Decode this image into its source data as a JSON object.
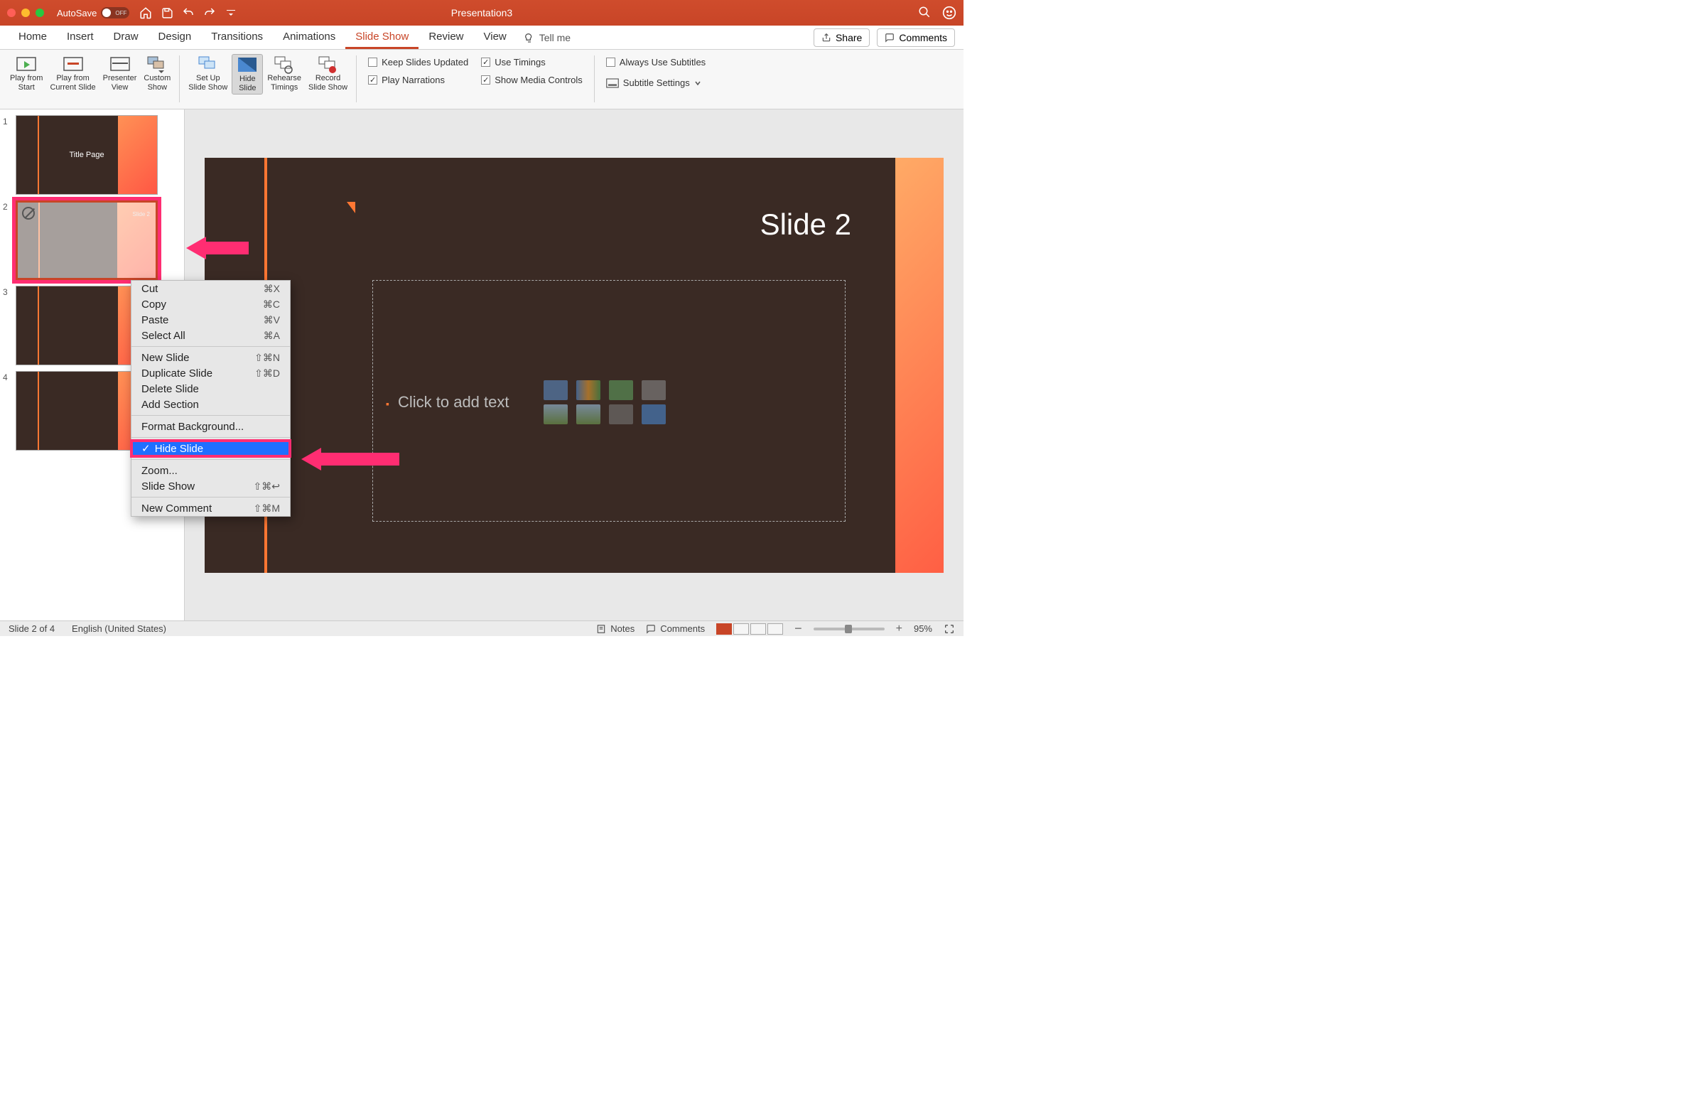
{
  "titlebar": {
    "autosave_label": "AutoSave",
    "autosave_state": "OFF",
    "document_title": "Presentation3"
  },
  "tabs": {
    "items": [
      "Home",
      "Insert",
      "Draw",
      "Design",
      "Transitions",
      "Animations",
      "Slide Show",
      "Review",
      "View"
    ],
    "active_index": 6,
    "tell_me": "Tell me",
    "share": "Share",
    "comments": "Comments"
  },
  "ribbon": {
    "buttons": [
      {
        "label": "Play from\nStart"
      },
      {
        "label": "Play from\nCurrent Slide"
      },
      {
        "label": "Presenter\nView"
      },
      {
        "label": "Custom\nShow"
      },
      {
        "label": "Set Up\nSlide Show"
      },
      {
        "label": "Hide\nSlide",
        "active": true
      },
      {
        "label": "Rehearse\nTimings"
      },
      {
        "label": "Record\nSlide Show"
      }
    ],
    "checks1": [
      {
        "label": "Keep Slides Updated",
        "checked": false
      },
      {
        "label": "Play Narrations",
        "checked": true
      }
    ],
    "checks2": [
      {
        "label": "Use Timings",
        "checked": true
      },
      {
        "label": "Show Media Controls",
        "checked": true
      }
    ],
    "checks3": [
      {
        "label": "Always Use Subtitles",
        "checked": false
      }
    ],
    "subtitle_settings": "Subtitle Settings"
  },
  "thumbs": [
    {
      "n": "1",
      "title_center": "Title Page"
    },
    {
      "n": "2",
      "title_right": "Slide 2",
      "selected": true,
      "hidden": true
    },
    {
      "n": "3",
      "title_right": ""
    },
    {
      "n": "4",
      "title_right": ""
    }
  ],
  "canvas": {
    "title": "Slide 2",
    "placeholder_text": "Click to add text"
  },
  "context_menu": {
    "items": [
      {
        "label": "Cut",
        "shortcut": "⌘X"
      },
      {
        "label": "Copy",
        "shortcut": "⌘C"
      },
      {
        "label": "Paste",
        "shortcut": "⌘V"
      },
      {
        "label": "Select All",
        "shortcut": "⌘A"
      },
      {
        "sep": true
      },
      {
        "label": "New Slide",
        "shortcut": "⇧⌘N"
      },
      {
        "label": "Duplicate Slide",
        "shortcut": "⇧⌘D"
      },
      {
        "label": "Delete Slide"
      },
      {
        "label": "Add Section"
      },
      {
        "sep": true
      },
      {
        "label": "Format Background..."
      },
      {
        "sep": true
      },
      {
        "label": "Hide Slide",
        "highlight": true,
        "checked": true
      },
      {
        "sep": true
      },
      {
        "label": "Zoom..."
      },
      {
        "label": "Slide Show",
        "shortcut": "⇧⌘↩"
      },
      {
        "sep": true
      },
      {
        "label": "New Comment",
        "shortcut": "⇧⌘M"
      }
    ]
  },
  "status": {
    "slide_info": "Slide 2 of 4",
    "language": "English (United States)",
    "notes": "Notes",
    "comments": "Comments",
    "zoom": "95%"
  }
}
